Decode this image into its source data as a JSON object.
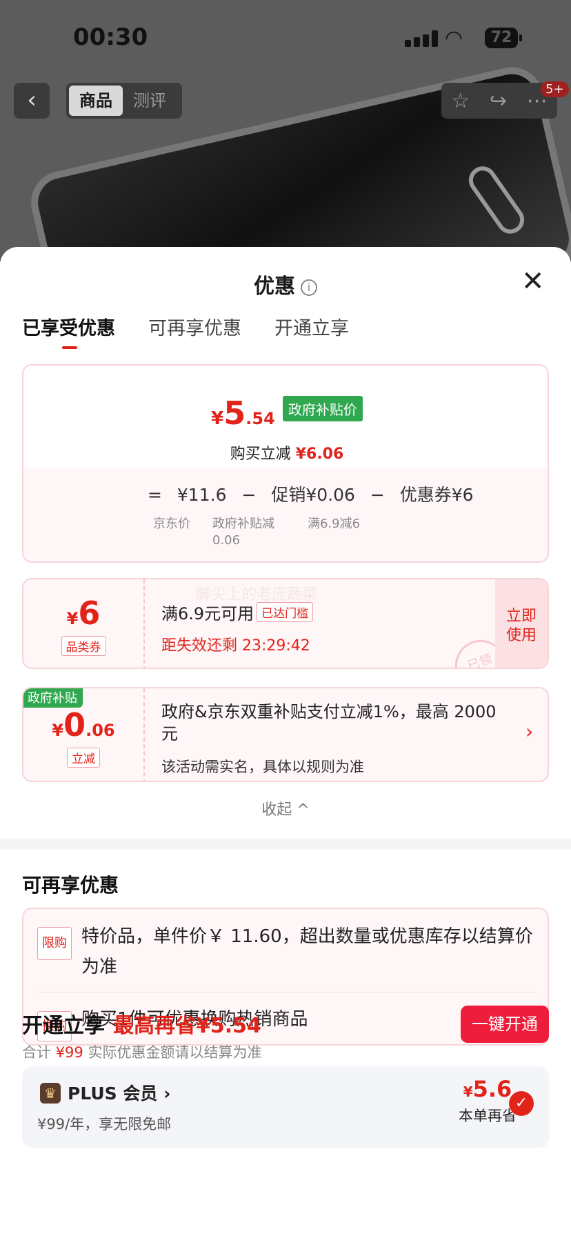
{
  "status": {
    "time": "00:30",
    "battery": "72"
  },
  "nav": {
    "back": "‹",
    "tabs": [
      "商品",
      "测评"
    ],
    "badge": "5+"
  },
  "sheet": {
    "title": "优惠",
    "close": "✕",
    "tabs": [
      "已享受优惠",
      "可再享优惠",
      "开通立享"
    ],
    "summary": {
      "currency": "¥",
      "price_int": "5",
      "price_dec": ".54",
      "gov_tag": "政府补贴价",
      "reduce_label": "购买立减",
      "reduce_value": "¥6.06",
      "eq": "=",
      "base_price": "¥11.6",
      "minus1": "−",
      "promo": "促销¥0.06",
      "minus2": "−",
      "coupon": "优惠券¥6",
      "base_label": "京东价",
      "promo_label_1": "政府补贴减",
      "promo_label_2": "0.06",
      "coupon_label": "满6.9减6"
    },
    "coupon_card": {
      "currency": "¥",
      "amount": "6",
      "type": "品类券",
      "condition": "满6.9元可用",
      "reached": "已达门槛",
      "countdown": "距失效还剩 23:29:42",
      "use_1": "立即",
      "use_2": "使用",
      "stamp": "已领",
      "watermark": "脚尖上的老庞蔬菜"
    },
    "subsidy_card": {
      "gov_tag": "政府补贴",
      "currency": "¥",
      "amount_int": "0",
      "amount_dec": ".06",
      "tag": "立减",
      "desc": "政府&京东双重补贴支付立减1%，最高 2000元",
      "note": "该活动需实名，具体以规则为准",
      "chevron": "›"
    },
    "collapse": "收起 ^"
  },
  "more": {
    "title": "可再享优惠",
    "row1_tag": "限购",
    "row1_text": "特价品，单件价￥ 11.60，超出数量或优惠库存以结算价为准",
    "row2_tag": "换购",
    "row2_text": "购买1件可优惠换购热销商品",
    "chevron": "›"
  },
  "plus": {
    "title": "开通立享",
    "highlight": "最高再省¥5.54",
    "sub_prefix": "合计",
    "sub_price": "¥99",
    "sub_suffix": "实际优惠金额请以结算为准",
    "button": "一键开通",
    "crown": "♛",
    "name": "PLUS 会员 ›",
    "desc": "¥99/年，享无限免邮",
    "save_currency": "¥",
    "save_value": "5.6",
    "save_label": "本单再省",
    "check": "✓"
  }
}
